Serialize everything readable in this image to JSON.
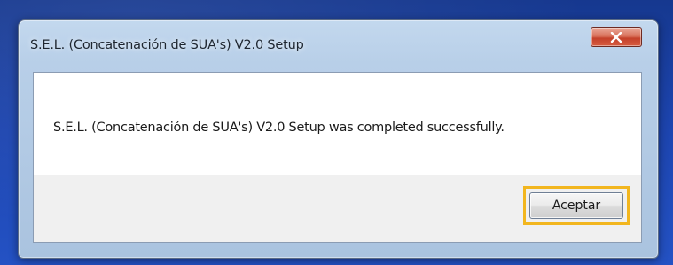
{
  "window": {
    "title": "S.E.L. (Concatenación de SUA's) V2.0 Setup"
  },
  "dialog": {
    "message": "S.E.L. (Concatenación de SUA's) V2.0 Setup was completed successfully.",
    "ok_label": "Aceptar"
  },
  "colors": {
    "desktop": "#1d45b0",
    "window_frame": "#b8cfe8",
    "close_button": "#c4412b",
    "highlight": "#f2b61f"
  },
  "icons": {
    "close": "close-icon"
  }
}
